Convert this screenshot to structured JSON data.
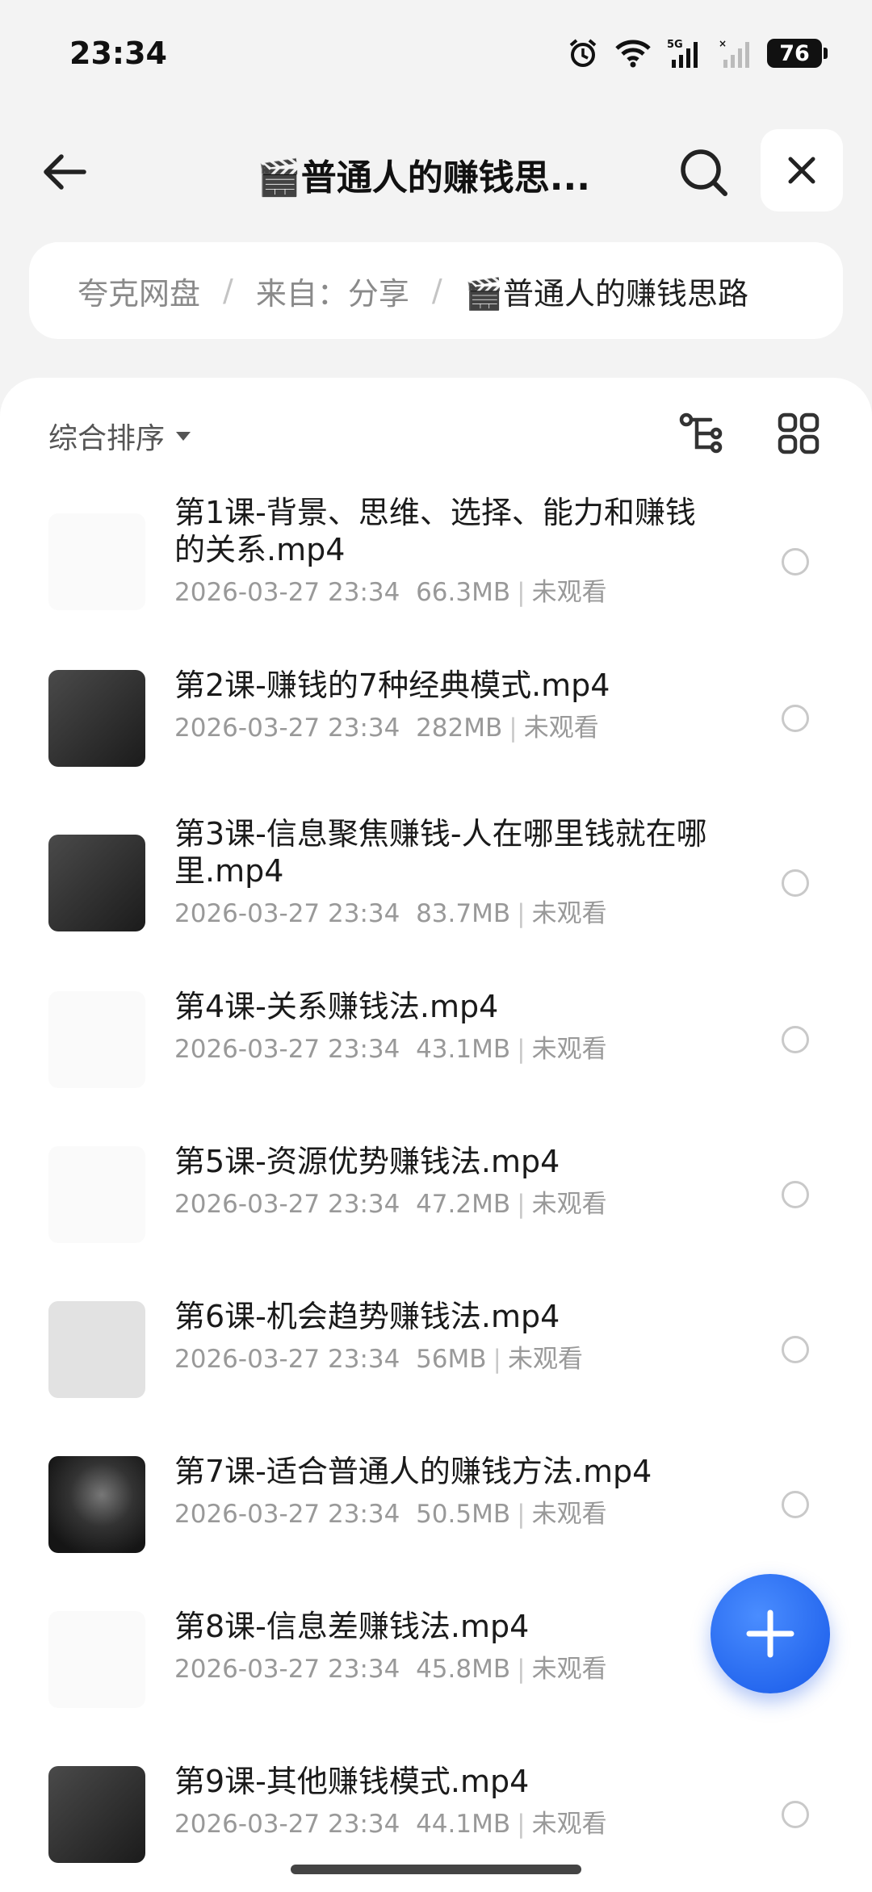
{
  "status_bar": {
    "time": "23:34",
    "battery": "76",
    "network": "5G"
  },
  "header": {
    "title": "🎬普通人的赚钱思..."
  },
  "breadcrumb": {
    "items": [
      "夸克网盘",
      "来自：分享",
      "🎬普通人的赚钱思路"
    ],
    "separator": "/"
  },
  "sort": {
    "label": "综合排序"
  },
  "files": [
    {
      "name": "第1课-背景、思维、选择、能力和赚钱的关系.mp4",
      "date": "2026-03-27 23:34",
      "size": "66.3MB",
      "status": "未观看",
      "thumb": "doc"
    },
    {
      "name": "第2课-赚钱的7种经典模式.mp4",
      "date": "2026-03-27 23:34",
      "size": "282MB",
      "status": "未观看",
      "thumb": "dark"
    },
    {
      "name": "第3课-信息聚焦赚钱-人在哪里钱就在哪里.mp4",
      "date": "2026-03-27 23:34",
      "size": "83.7MB",
      "status": "未观看",
      "thumb": "dark"
    },
    {
      "name": "第4课-关系赚钱法.mp4",
      "date": "2026-03-27 23:34",
      "size": "43.1MB",
      "status": "未观看",
      "thumb": "doc"
    },
    {
      "name": "第5课-资源优势赚钱法.mp4",
      "date": "2026-03-27 23:34",
      "size": "47.2MB",
      "status": "未观看",
      "thumb": "doc"
    },
    {
      "name": "第6课-机会趋势赚钱法.mp4",
      "date": "2026-03-27 23:34",
      "size": "56MB",
      "status": "未观看",
      "thumb": "gray"
    },
    {
      "name": "第7课-适合普通人的赚钱方法.mp4",
      "date": "2026-03-27 23:34",
      "size": "50.5MB",
      "status": "未观看",
      "thumb": "photo"
    },
    {
      "name": "第8课-信息差赚钱法.mp4",
      "date": "2026-03-27 23:34",
      "size": "45.8MB",
      "status": "未观看",
      "thumb": "doc"
    },
    {
      "name": "第9课-其他赚钱模式.mp4",
      "date": "2026-03-27 23:34",
      "size": "44.1MB",
      "status": "未观看",
      "thumb": "dark"
    }
  ],
  "colors": {
    "accent": "#1759e8",
    "background": "#f3f3f3",
    "card": "#ffffff"
  }
}
